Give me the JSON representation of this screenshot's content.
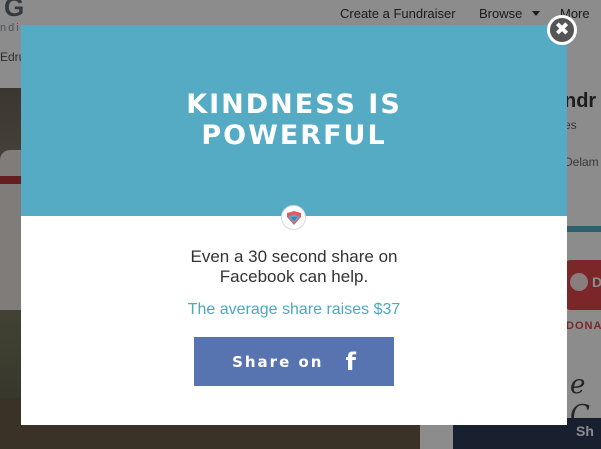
{
  "background": {
    "logo": "G",
    "logo_sub": "ndin",
    "nav": {
      "create": "Create a Fundraiser",
      "browse": "Browse",
      "more": "More"
    },
    "sub_bar": "Edru",
    "right_column": {
      "title": "ndr",
      "subtitle": "es",
      "location": "Delam",
      "donate_letter": "D",
      "donate_text": "DONA",
      "script_text": "e C",
      "share_label": "Sh"
    }
  },
  "modal": {
    "title": "KINDNESS IS\nPOWERFUL",
    "badge_icon": "heart-shield-icon",
    "message": "Even a 30 second share on\nFacebook can help.",
    "stat": "The average share raises $37",
    "share_button": {
      "label": "Share on",
      "icon": "f"
    },
    "close_icon": "✖"
  },
  "colors": {
    "header_blue": "#55abc4",
    "stat_teal": "#4aa9c2",
    "facebook_blue": "#5774b0",
    "donate_red": "#e0474c"
  }
}
